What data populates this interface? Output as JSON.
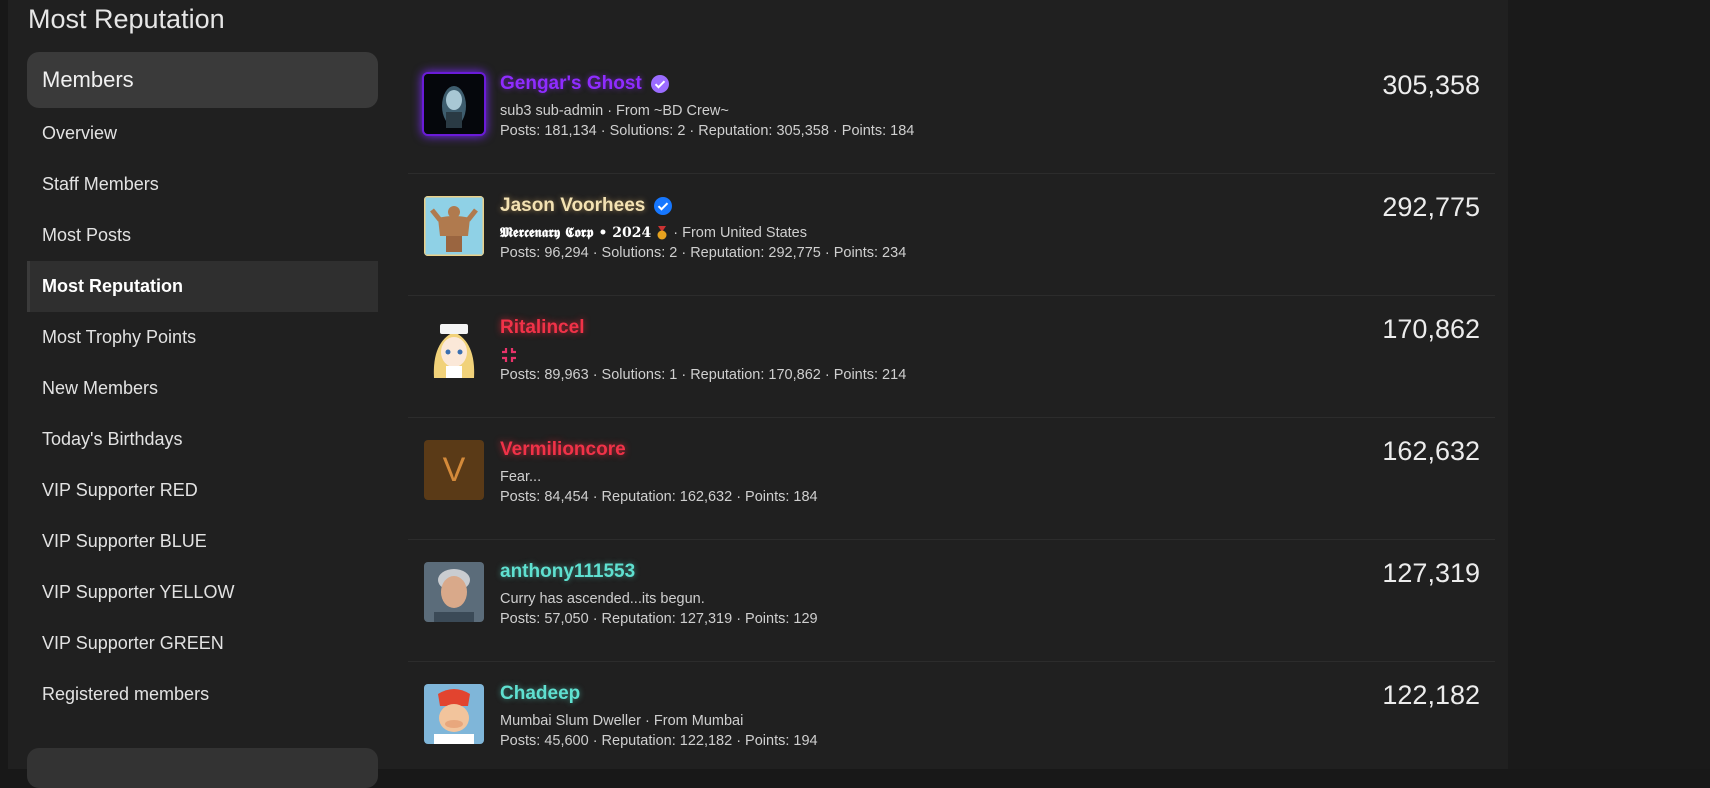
{
  "page": {
    "title": "Most Reputation"
  },
  "sidebar": {
    "header": "Members",
    "items": [
      {
        "label": "Overview"
      },
      {
        "label": "Staff Members"
      },
      {
        "label": "Most Posts"
      },
      {
        "label": "Most Reputation",
        "active": true
      },
      {
        "label": "Most Trophy Points"
      },
      {
        "label": "New Members"
      },
      {
        "label": "Today's Birthdays"
      },
      {
        "label": "VIP Supporter RED"
      },
      {
        "label": "VIP Supporter BLUE"
      },
      {
        "label": "VIP Supporter YELLOW"
      },
      {
        "label": "VIP Supporter GREEN"
      },
      {
        "label": "Registered members"
      }
    ]
  },
  "members": [
    {
      "name": "Gengar's Ghost",
      "name_color": "#8f2cff",
      "badge": "verified-purple-icon",
      "title": "sub3 sub-admin · From ~BD Crew~",
      "stats": "Posts: 181,134 · Solutions: 2 · Reputation: 305,358 · Points: 184",
      "reputation": "305,358"
    },
    {
      "name": "Jason Voorhees",
      "name_color": "#f3e2b3",
      "badge": "verified-blue-icon",
      "title_fraktur": "𝕸𝖊𝖗𝖈𝖊𝖓𝖆𝖗𝖞 𝕮𝖔𝖗𝖕 • 2024",
      "title_suffix": "· From United States",
      "stats": "Posts: 96,294 · Solutions: 2 · Reputation: 292,775 · Points: 234",
      "reputation": "292,775"
    },
    {
      "name": "Ritalincel",
      "name_color": "#f03248",
      "title_icon": "anger-symbol-icon",
      "stats": "Posts: 89,963 · Solutions: 1 · Reputation: 170,862 · Points: 214",
      "reputation": "170,862"
    },
    {
      "name": "Vermilioncore",
      "name_color": "#f03248",
      "avatar_letter": "V",
      "title": "Fear...",
      "stats": "Posts: 84,454 · Reputation: 162,632 · Points: 184",
      "reputation": "162,632"
    },
    {
      "name": "anthony111553",
      "name_color": "#5fe0d0",
      "title": "Curry has ascended...its begun.",
      "stats": "Posts: 57,050 · Reputation: 127,319 · Points: 129",
      "reputation": "127,319"
    },
    {
      "name": "Chadeep",
      "name_color": "#5fe0d0",
      "title": "Mumbai Slum Dweller · From Mumbai",
      "stats": "Posts: 45,600 · Reputation: 122,182 · Points: 194",
      "reputation": "122,182"
    }
  ]
}
